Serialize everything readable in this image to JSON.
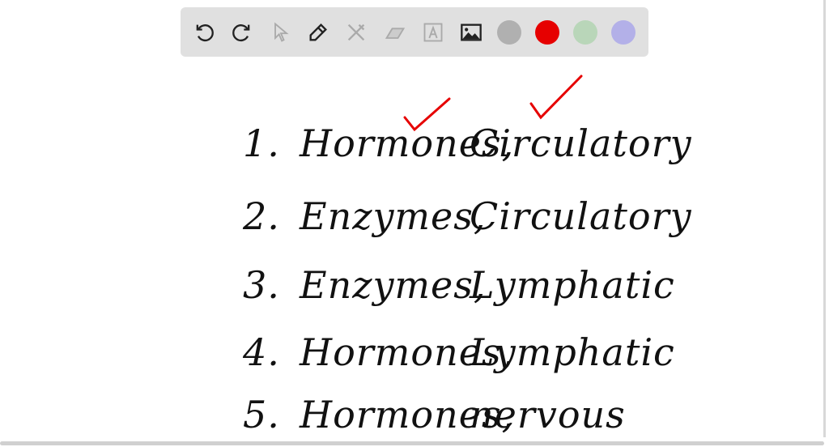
{
  "toolbar": {
    "tools": [
      "undo-icon",
      "redo-icon",
      "select-icon",
      "pen-icon",
      "tools-icon",
      "eraser-icon",
      "text-icon",
      "image-icon"
    ],
    "colors": [
      "#b0b0b0",
      "#e60000",
      "#b9d6b9",
      "#b3b0e8"
    ]
  },
  "lines": [
    {
      "num": "1.",
      "a": "Hormones,",
      "b": "Circulatory"
    },
    {
      "num": "2.",
      "a": "Enzymes,",
      "b": "Circulatory"
    },
    {
      "num": "3.",
      "a": "Enzymes,",
      "b": "Lymphatic"
    },
    {
      "num": "4.",
      "a": "Hormones,",
      "b": "Lymphatic"
    },
    {
      "num": "5.",
      "a": "Hormones,",
      "b": "nervous"
    }
  ],
  "check_color": "#e60000"
}
